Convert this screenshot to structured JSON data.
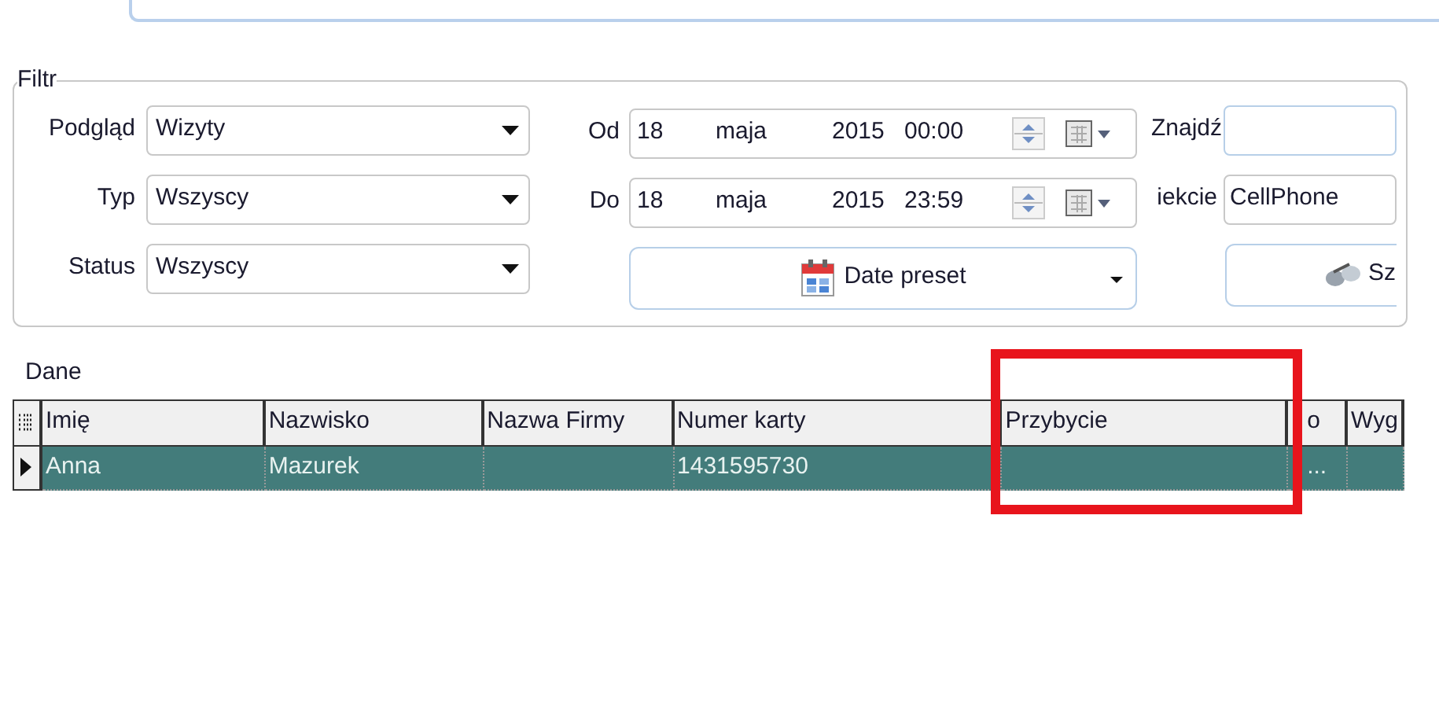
{
  "filter": {
    "title": "Filtr",
    "combos": [
      {
        "label": "Podgląd",
        "value": "Wizyty"
      },
      {
        "label": "Typ",
        "value": "Wszyscy"
      },
      {
        "label": "Status",
        "value": "Wszyscy"
      }
    ],
    "dates": [
      {
        "label": "Od",
        "day": "18",
        "month": "maja",
        "year": "2015",
        "time": "00:00"
      },
      {
        "label": "Do",
        "day": "18",
        "month": "maja",
        "year": "2015",
        "time": "23:59"
      }
    ],
    "date_preset": "Date preset",
    "search": {
      "label": "Znajdź"
    },
    "object": {
      "label": "iekcie",
      "value": "CellPhone"
    },
    "search_button": "Sz"
  },
  "data": {
    "title": "Dane",
    "columns": [
      "Imię",
      "Nazwisko",
      "Nazwa Firmy",
      "Numer karty",
      "Przybycie",
      "o",
      "Wyg"
    ],
    "rows": [
      {
        "selected": true,
        "cells": [
          "Anna",
          "Mazurek",
          "",
          "1431595730",
          "",
          "...",
          ""
        ]
      }
    ]
  }
}
